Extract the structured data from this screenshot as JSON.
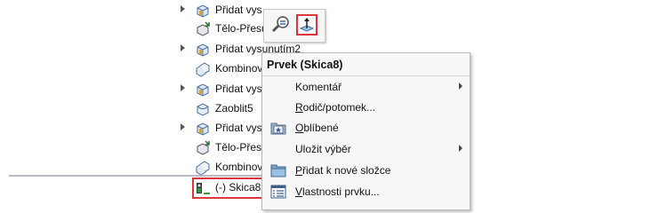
{
  "tree": {
    "items": [
      {
        "label": "Přidat vys",
        "icon": "extrude-icon",
        "expandable": true
      },
      {
        "label": "Tělo-Přesu",
        "icon": "move-body-icon",
        "expandable": false
      },
      {
        "label": "Přidat vysunutím2",
        "icon": "extrude-icon",
        "expandable": true
      },
      {
        "label": "Kombinov",
        "icon": "combine-icon",
        "expandable": false
      },
      {
        "label": "Přidat vys",
        "icon": "extrude-icon",
        "expandable": true
      },
      {
        "label": "Zaoblit5",
        "icon": "fillet-icon",
        "expandable": false
      },
      {
        "label": "Přidat vys",
        "icon": "extrude-icon",
        "expandable": true
      },
      {
        "label": "Tělo-Přesu",
        "icon": "move-body-icon",
        "expandable": false
      },
      {
        "label": "Kombinov",
        "icon": "combine-icon",
        "expandable": false
      }
    ],
    "selected": {
      "label": "(-) Skica8",
      "icon": "sketch-icon"
    }
  },
  "minibar": {
    "buttons": [
      {
        "name": "zoom-to-selection-icon",
        "selected": false
      },
      {
        "name": "normal-to-icon",
        "selected": true
      }
    ]
  },
  "context_menu": {
    "title": "Prvek (Skica8)",
    "items": [
      {
        "pre": "Komentář",
        "u": "",
        "post": "",
        "icon": "",
        "submenu": true
      },
      {
        "pre": "",
        "u": "R",
        "post": "odič/potomek...",
        "icon": "",
        "submenu": false
      },
      {
        "pre": "",
        "u": "O",
        "post": "blíbené",
        "icon": "favorites-folder-icon",
        "submenu": false
      },
      {
        "pre": "Uložit výběr",
        "u": "",
        "post": "",
        "icon": "",
        "submenu": true
      },
      {
        "pre": "",
        "u": "P",
        "post": "řidat k nové složce",
        "icon": "new-folder-icon",
        "submenu": false
      },
      {
        "pre": "",
        "u": "V",
        "post": "lastnosti prvku...",
        "icon": "feature-properties-icon",
        "submenu": false
      }
    ]
  },
  "colors": {
    "highlight": "#d9363e",
    "menu_bg": "#f7f7f7"
  }
}
